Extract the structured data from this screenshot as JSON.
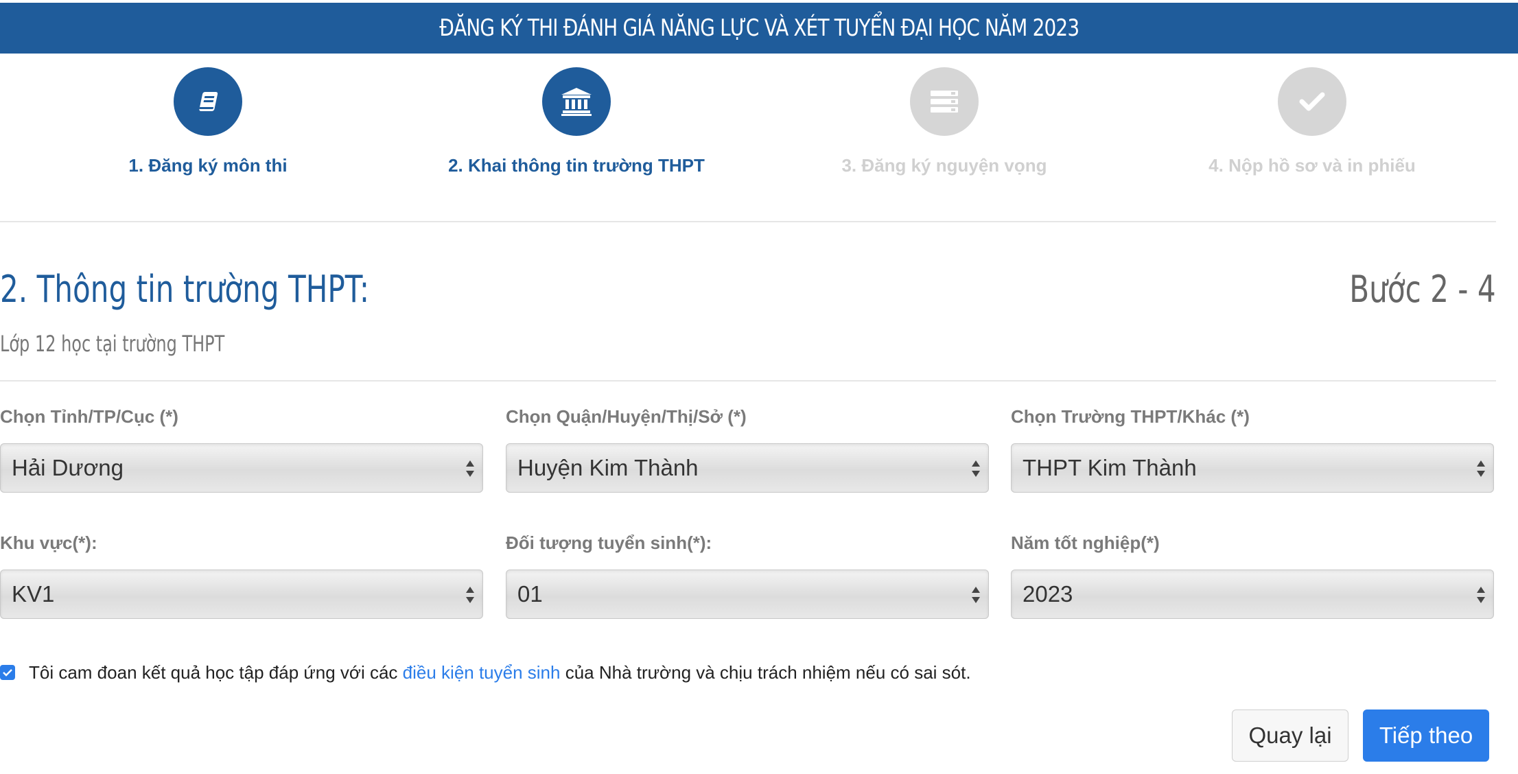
{
  "banner": {
    "title": "ĐĂNG KÝ THI ĐÁNH GIÁ NĂNG LỰC VÀ XÉT TUYỂN ĐẠI HỌC NĂM 2023"
  },
  "steps": [
    {
      "label": "1. Đăng ký môn thi",
      "icon": "book-icon",
      "state": "active"
    },
    {
      "label": "2. Khai thông tin trường THPT",
      "icon": "institution-icon",
      "state": "active"
    },
    {
      "label": "3. Đăng ký nguyện vọng",
      "icon": "list-icon",
      "state": "inactive"
    },
    {
      "label": "4. Nộp hồ sơ và in phiếu",
      "icon": "check-icon",
      "state": "inactive"
    }
  ],
  "section": {
    "title": "2. Thông tin trường THPT:",
    "step_count": "Bước 2 - 4",
    "subtitle": "Lớp 12 học tại trường THPT"
  },
  "fields": {
    "province": {
      "label": "Chọn Tỉnh/TP/Cục (*)",
      "value": "Hải Dương"
    },
    "district": {
      "label": "Chọn Quận/Huyện/Thị/Sở (*)",
      "value": "Huyện Kim Thành"
    },
    "school": {
      "label": "Chọn Trường THPT/Khác (*)",
      "value": "THPT Kim Thành"
    },
    "region": {
      "label": "Khu vực(*):",
      "value": "KV1"
    },
    "priority": {
      "label": "Đối tượng tuyển sinh(*):",
      "value": "01"
    },
    "grad_year": {
      "label": "Năm tốt nghiệp(*)",
      "value": "2023"
    }
  },
  "agreement": {
    "checked": true,
    "text_before": "Tôi cam đoan kết quả học tập đáp ứng với các ",
    "link_text": "điều kiện tuyển sinh",
    "text_after": " của Nhà trường và chịu trách nhiệm nếu có sai sót."
  },
  "buttons": {
    "back": "Quay lại",
    "next": "Tiếp theo"
  },
  "colors": {
    "primary": "#1f5c9b",
    "accent": "#2b7de9",
    "inactive": "#d6d6d6"
  }
}
